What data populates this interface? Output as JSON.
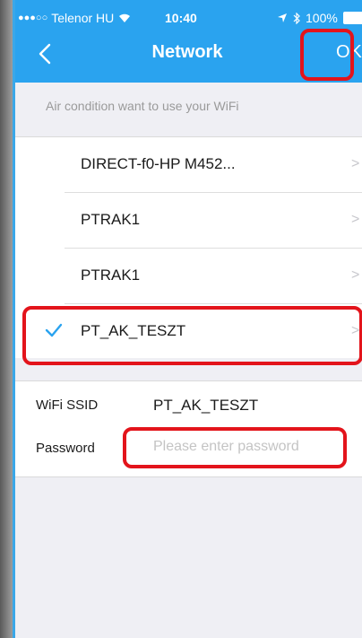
{
  "status_bar": {
    "carrier": "Telenor HU",
    "time": "10:40",
    "battery": "100%"
  },
  "nav": {
    "title": "Network",
    "ok_label": "OK"
  },
  "hint": "Air condition want to use your WiFi",
  "networks": [
    {
      "name": "DIRECT-f0-HP M452...",
      "selected": false
    },
    {
      "name": "PTRAK1",
      "selected": false
    },
    {
      "name": "PTRAK1",
      "selected": false
    },
    {
      "name": "PT_AK_TESZT",
      "selected": true
    }
  ],
  "form": {
    "ssid_label": "WiFi SSID",
    "ssid_value": "PT_AK_TESZT",
    "password_label": "Password",
    "password_placeholder": "Please enter password"
  },
  "colors": {
    "nav_bg": "#2aa3ef",
    "highlight": "#e3141b",
    "check": "#2aa3ef"
  }
}
